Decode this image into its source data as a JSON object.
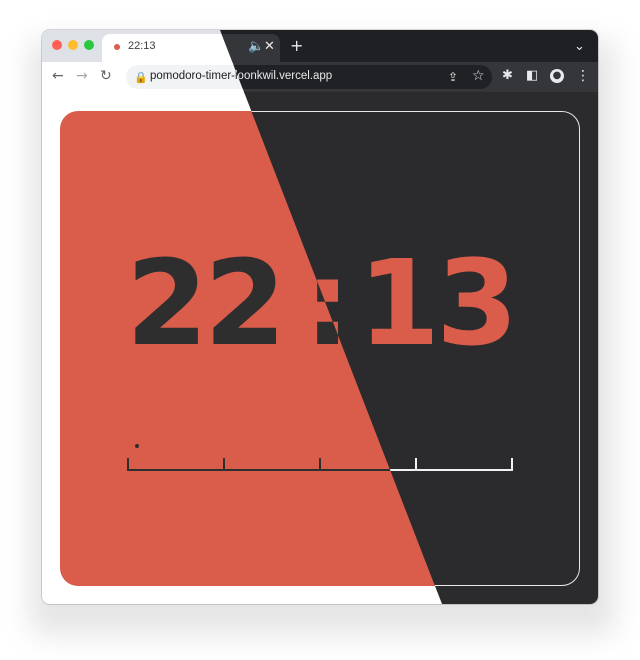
{
  "browser": {
    "tab_title": "22:13",
    "url_host": "pomodoro-timer-loonkwil.vercel.app",
    "icons": {
      "audio": "🔈",
      "close": "✕",
      "new_tab": "+",
      "tab_menu": "⌄",
      "back": "←",
      "forward": "→",
      "reload": "↻",
      "lock": "🔒",
      "share": "⇪",
      "bookmark": "☆",
      "extensions": "✱",
      "side_panel": "◧",
      "profile": "●",
      "menu": "⋮"
    }
  },
  "timer": {
    "minutes": "22",
    "separator": ":",
    "seconds": "13"
  },
  "progress": {
    "segments": 4,
    "elapsed_fraction": 0.0
  },
  "colors": {
    "accent": "#da5c4a",
    "dark_bg": "#2b2b2d",
    "text_dark": "#2e2e2e"
  }
}
